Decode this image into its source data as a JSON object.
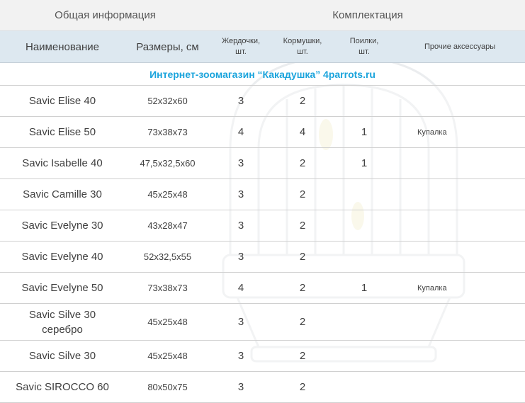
{
  "header": {
    "group_general": "Общая информация",
    "group_kit": "Комплектация",
    "col_name": "Наименование",
    "col_size": "Размеры, см",
    "col_perches": [
      "Жердочки,",
      "шт."
    ],
    "col_feeders": [
      "Кормушки,",
      "шт."
    ],
    "col_drinkers": [
      "Поилки,",
      "шт."
    ],
    "col_other": "Прочие аксессуары"
  },
  "banner": "Интернет-зоомагазин “Какадушка” 4parrots.ru",
  "rows": [
    {
      "name": "Savic Elise 40",
      "size": "52x32x60",
      "perches": "3",
      "feeders": "2",
      "drinkers": "",
      "other": ""
    },
    {
      "name": "Savic Elise 50",
      "size": "73x38x73",
      "perches": "4",
      "feeders": "4",
      "drinkers": "1",
      "other": "Купалка"
    },
    {
      "name": "Savic Isabelle 40",
      "size": "47,5x32,5x60",
      "perches": "3",
      "feeders": "2",
      "drinkers": "1",
      "other": ""
    },
    {
      "name": "Savic Camille 30",
      "size": "45x25x48",
      "perches": "3",
      "feeders": "2",
      "drinkers": "",
      "other": ""
    },
    {
      "name": "Savic Evelyne 30",
      "size": "43x28x47",
      "perches": "3",
      "feeders": "2",
      "drinkers": "",
      "other": ""
    },
    {
      "name": "Savic Evelyne 40",
      "size": "52x32,5x55",
      "perches": "3",
      "feeders": "2",
      "drinkers": "",
      "other": ""
    },
    {
      "name": "Savic Evelyne 50",
      "size": "73x38x73",
      "perches": "4",
      "feeders": "2",
      "drinkers": "1",
      "other": "Купалка"
    },
    {
      "name": [
        "Savic Silve 30",
        "серебро"
      ],
      "size": "45x25x48",
      "perches": "3",
      "feeders": "2",
      "drinkers": "",
      "other": ""
    },
    {
      "name": "Savic Silve 30",
      "size": "45x25x48",
      "perches": "3",
      "feeders": "2",
      "drinkers": "",
      "other": ""
    },
    {
      "name": "Savic SIROCCO 60",
      "size": "80x50x75",
      "perches": "3",
      "feeders": "2",
      "drinkers": "",
      "other": ""
    }
  ],
  "colors": {
    "banner_text": "#1ba4dc",
    "group_header_bg": "#f2f2f2",
    "column_header_bg": "#dde8f0",
    "row_border": "#d0d0d0"
  },
  "watermark_icon": "bird-cage-icon"
}
